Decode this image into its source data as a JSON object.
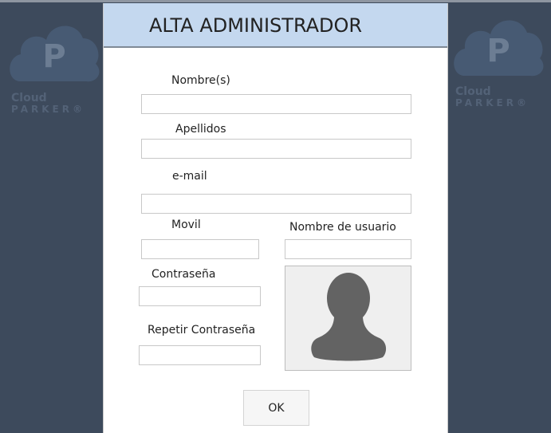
{
  "title": "ALTA ADMINISTRADOR",
  "brand": {
    "line1": "Cloud",
    "line2": "PARKER®",
    "logo_letter": "P",
    "icon": "cloud-parking-logo"
  },
  "form": {
    "nombres_label": "Nombre(s)",
    "apellidos_label": "Apellidos",
    "email_label": "e-mail",
    "movil_label": "Movil",
    "usuario_label": "Nombre de usuario",
    "contrasena_label": "Contraseña",
    "repetir_label": "Repetir Contraseña",
    "photo_icon": "user-silhouette-icon",
    "ok_label": "OK"
  },
  "colors": {
    "background": "#3d4a5c",
    "header": "#c4d8ef",
    "logo_cloud": "#475a73",
    "logo_text": "#536277"
  }
}
